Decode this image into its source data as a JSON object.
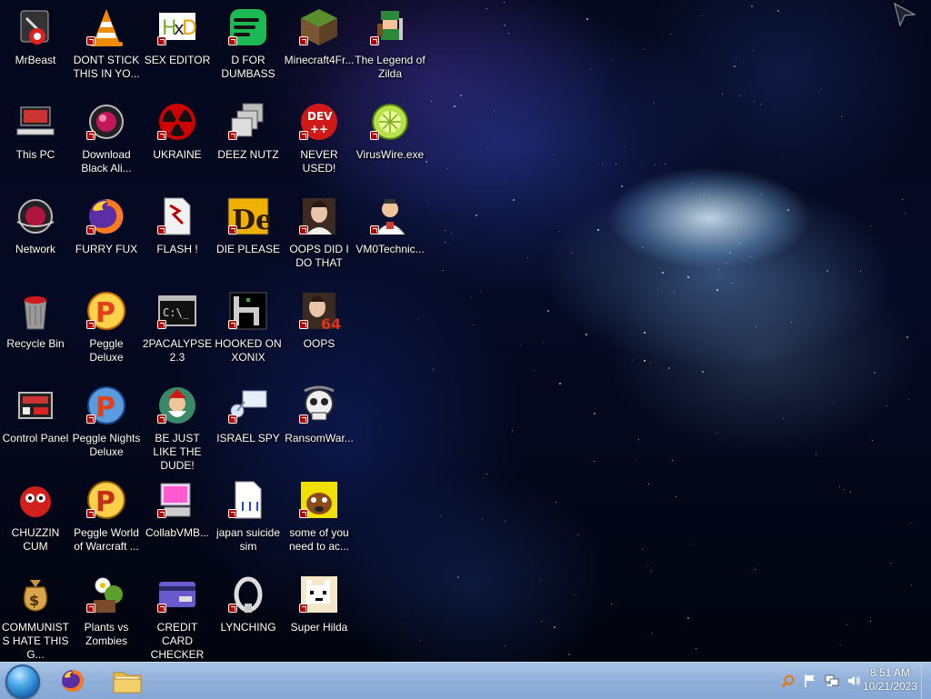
{
  "desktop": {
    "icons": [
      {
        "label": "MrBeast",
        "icon": "mrbeast-icon"
      },
      {
        "label": "DONT STICK THIS IN YO...",
        "icon": "vlc-cone-icon"
      },
      {
        "label": "SEX EDITOR",
        "icon": "hex-editor-icon"
      },
      {
        "label": "D FOR DUMBASS",
        "icon": "spotify-style-icon"
      },
      {
        "label": "Minecraft4Fr...",
        "icon": "minecraft-grass-icon"
      },
      {
        "label": "The Legend of Zilda",
        "icon": "pixel-hero-icon"
      },
      {
        "label": "This PC",
        "icon": "computer-icon"
      },
      {
        "label": "Download Black Ali...",
        "icon": "red-orb-icon"
      },
      {
        "label": "UKRAINE",
        "icon": "radiation-icon"
      },
      {
        "label": "DEEZ NUTZ",
        "icon": "stacked-windows-icon"
      },
      {
        "label": "NEVER USED!",
        "icon": "devcpp-icon"
      },
      {
        "label": "VirusWire.exe",
        "icon": "limewire-icon"
      },
      {
        "label": "Network",
        "icon": "network-orb-icon"
      },
      {
        "label": "FURRY FUX",
        "icon": "firefox-icon"
      },
      {
        "label": "FLASH !",
        "icon": "flash-file-icon"
      },
      {
        "label": "DIE PLEASE",
        "icon": "die-logo-icon"
      },
      {
        "label": "OOPS DID I DO THAT",
        "icon": "portrait-icon"
      },
      {
        "label": "VM0Technic...",
        "icon": "doctor-icon"
      },
      {
        "label": "Recycle Bin",
        "icon": "recycle-bin-icon"
      },
      {
        "label": "Peggle Deluxe",
        "icon": "peggle-icon"
      },
      {
        "label": "2PACALYPSE 2.3",
        "icon": "terminal-icon"
      },
      {
        "label": "HOOKED ON XONIX",
        "icon": "xonix-icon"
      },
      {
        "label": "OOPS",
        "icon": "portrait-64-icon"
      },
      {
        "label": "Control Panel",
        "icon": "control-panel-icon"
      },
      {
        "label": "Peggle Nights Deluxe",
        "icon": "peggle-nights-icon"
      },
      {
        "label": "BE JUST LIKE THE DUDE!",
        "icon": "santa-ball-icon"
      },
      {
        "label": "ISRAEL SPY",
        "icon": "spy-monitor-icon"
      },
      {
        "label": "RansomWar...",
        "icon": "skull-icon"
      },
      {
        "label": "CHUZZIN CUM",
        "icon": "chuzzle-icon"
      },
      {
        "label": "Peggle World of Warcraft ...",
        "icon": "peggle-wow-icon"
      },
      {
        "label": "CollabVMB...",
        "icon": "collabvm-icon"
      },
      {
        "label": "japan suicide sim",
        "icon": "document-icon"
      },
      {
        "label": "some of you need to ac...",
        "icon": "cartoon-dog-icon"
      },
      {
        "label": "COMMUNISTS HATE THIS G...",
        "icon": "money-bag-icon"
      },
      {
        "label": "Plants vs Zombies",
        "icon": "plants-icon"
      },
      {
        "label": "CREDIT CARD CHECKER",
        "icon": "credit-card-icon"
      },
      {
        "label": "LYNCHING",
        "icon": "noose-icon"
      },
      {
        "label": "Super Hilda",
        "icon": "pixel-cat-icon"
      }
    ]
  },
  "taskbar": {
    "start_icon": "windows-orb-icon",
    "pinned": [
      {
        "name": "firefox",
        "icon": "firefox-icon"
      },
      {
        "name": "file-explorer",
        "icon": "folder-icon"
      }
    ],
    "tray_icons": [
      "search-icon",
      "flag-icon",
      "network-icon",
      "speaker-icon"
    ],
    "time": "8:51 AM",
    "date": "10/21/2023"
  },
  "colors": {
    "taskbar": "#8fb0da",
    "shortcut_badge": "#b30000",
    "label_text": "#ffffff"
  }
}
